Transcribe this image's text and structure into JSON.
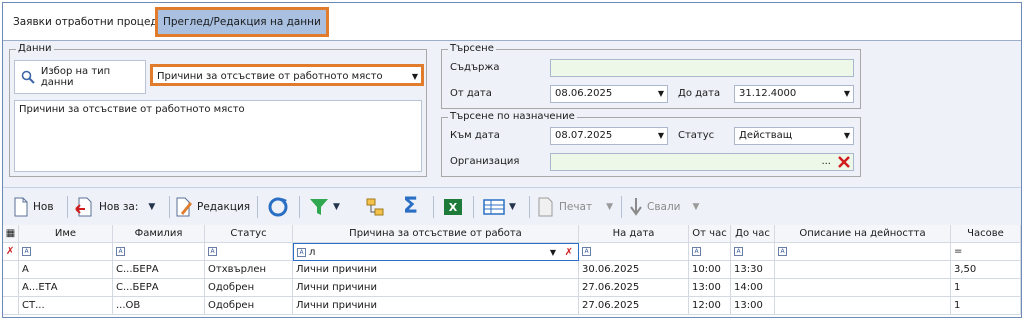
{
  "tabs": [
    {
      "label": "Заявки отработни процедури"
    },
    {
      "label": "Преглед/Редакция на данни"
    }
  ],
  "data_group": {
    "title": "Данни",
    "choose_type_label": "Избор на тип данни",
    "selected_type": "Причини за отсъствие от работното място",
    "description": "Причини за отсъствие от работното място"
  },
  "search_group": {
    "title": "Търсене",
    "contains_label": "Съдържа",
    "contains_value": "",
    "from_date_label": "От дата",
    "from_date_value": "08.06.2025",
    "to_date_label": "До дата",
    "to_date_value": "31.12.4000"
  },
  "assign_group": {
    "title": "Търсене по назначение",
    "to_date_label": "Към дата",
    "to_date_value": "08.07.2025",
    "status_label": "Статус",
    "status_value": "Действащ",
    "org_label": "Организация",
    "org_value": "",
    "org_ellipsis": "..."
  },
  "toolbar": {
    "new_label": "Нов",
    "new_for_label": "Нов за:",
    "edit_label": "Редакция",
    "print_label": "Печат",
    "download_label": "Свали"
  },
  "grid": {
    "columns": [
      "Име",
      "Фамилия",
      "Статус",
      "Причина за отсъствие от работа",
      "На дата",
      "От час",
      "До час",
      "Описание на дейността",
      "Часове"
    ],
    "filter": {
      "reason": "л",
      "hours": "="
    },
    "rows": [
      [
        "А",
        "С...БЕРА",
        "Отхвърлен",
        "Лични причини",
        "30.06.2025",
        "10:00",
        "13:30",
        "",
        "3,50"
      ],
      [
        "А...ЕТА",
        "С...БЕРА",
        "Одобрен",
        "Лични причини",
        "27.06.2025",
        "13:00",
        "14:00",
        "",
        "1"
      ],
      [
        "СТ...",
        "...ОВ",
        "Одобрен",
        "Лични причини",
        "27.06.2025",
        "12:00",
        "13:00",
        "",
        "1"
      ]
    ]
  },
  "colors": {
    "accent": "#e07c2c",
    "active_tab": "#a9c0e0",
    "frame": "#6e8bb8",
    "filter_bg": "#eef8e9"
  }
}
